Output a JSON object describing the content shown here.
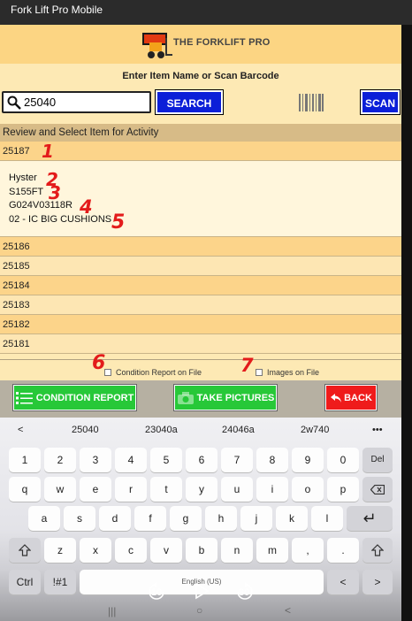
{
  "window": {
    "title": "Fork Lift Pro Mobile"
  },
  "logo": {
    "text": "THE FORKLIFT PRO"
  },
  "prompt": "Enter Item Name or Scan Barcode",
  "search": {
    "value": "25040",
    "button": "SEARCH",
    "scan_button": "SCAN"
  },
  "list_header": "Review and Select Item for Activity",
  "selected_item": {
    "id": "25187",
    "make": "Hyster",
    "model": "S155FT",
    "serial": "G024V03118R",
    "type": "02 - IC BIG CUSHIONS"
  },
  "other_items": [
    "25186",
    "25185",
    "25184",
    "25183",
    "25182",
    "25181"
  ],
  "checkboxes": {
    "condition_report": "Condition Report on File",
    "images": "Images on File"
  },
  "actions": {
    "condition_report": "CONDITION REPORT",
    "take_pictures": "TAKE PICTURES",
    "back": "BACK"
  },
  "annotations": [
    "1",
    "2",
    "3",
    "4",
    "5",
    "6",
    "7"
  ],
  "colors": {
    "accent_blue": "#0b1fd8",
    "green": "#27c838",
    "red": "#ef1b1b",
    "annotation": "#e31b1b"
  },
  "keyboard": {
    "suggestions": [
      "25040",
      "23040a",
      "24046a",
      "2w740",
      "•••"
    ],
    "back_arrow": "<",
    "row1": [
      "1",
      "2",
      "3",
      "4",
      "5",
      "6",
      "7",
      "8",
      "9",
      "0",
      "Del"
    ],
    "row2": [
      "q",
      "w",
      "e",
      "r",
      "t",
      "y",
      "u",
      "i",
      "o",
      "p"
    ],
    "row3": [
      "a",
      "s",
      "d",
      "f",
      "g",
      "h",
      "j",
      "k",
      "l"
    ],
    "row4": [
      "z",
      "x",
      "c",
      "v",
      "b",
      "n",
      "m"
    ],
    "row5": {
      "ctrl": "Ctrl",
      "sym": "!#1",
      "space": "English (US)",
      "left": "<",
      "right": ">"
    },
    "enter_symbol": "↵"
  },
  "media": {
    "rewind": "10",
    "forward": "30"
  },
  "navbar": {
    "recents": "|||",
    "home": "○",
    "back": "<"
  }
}
